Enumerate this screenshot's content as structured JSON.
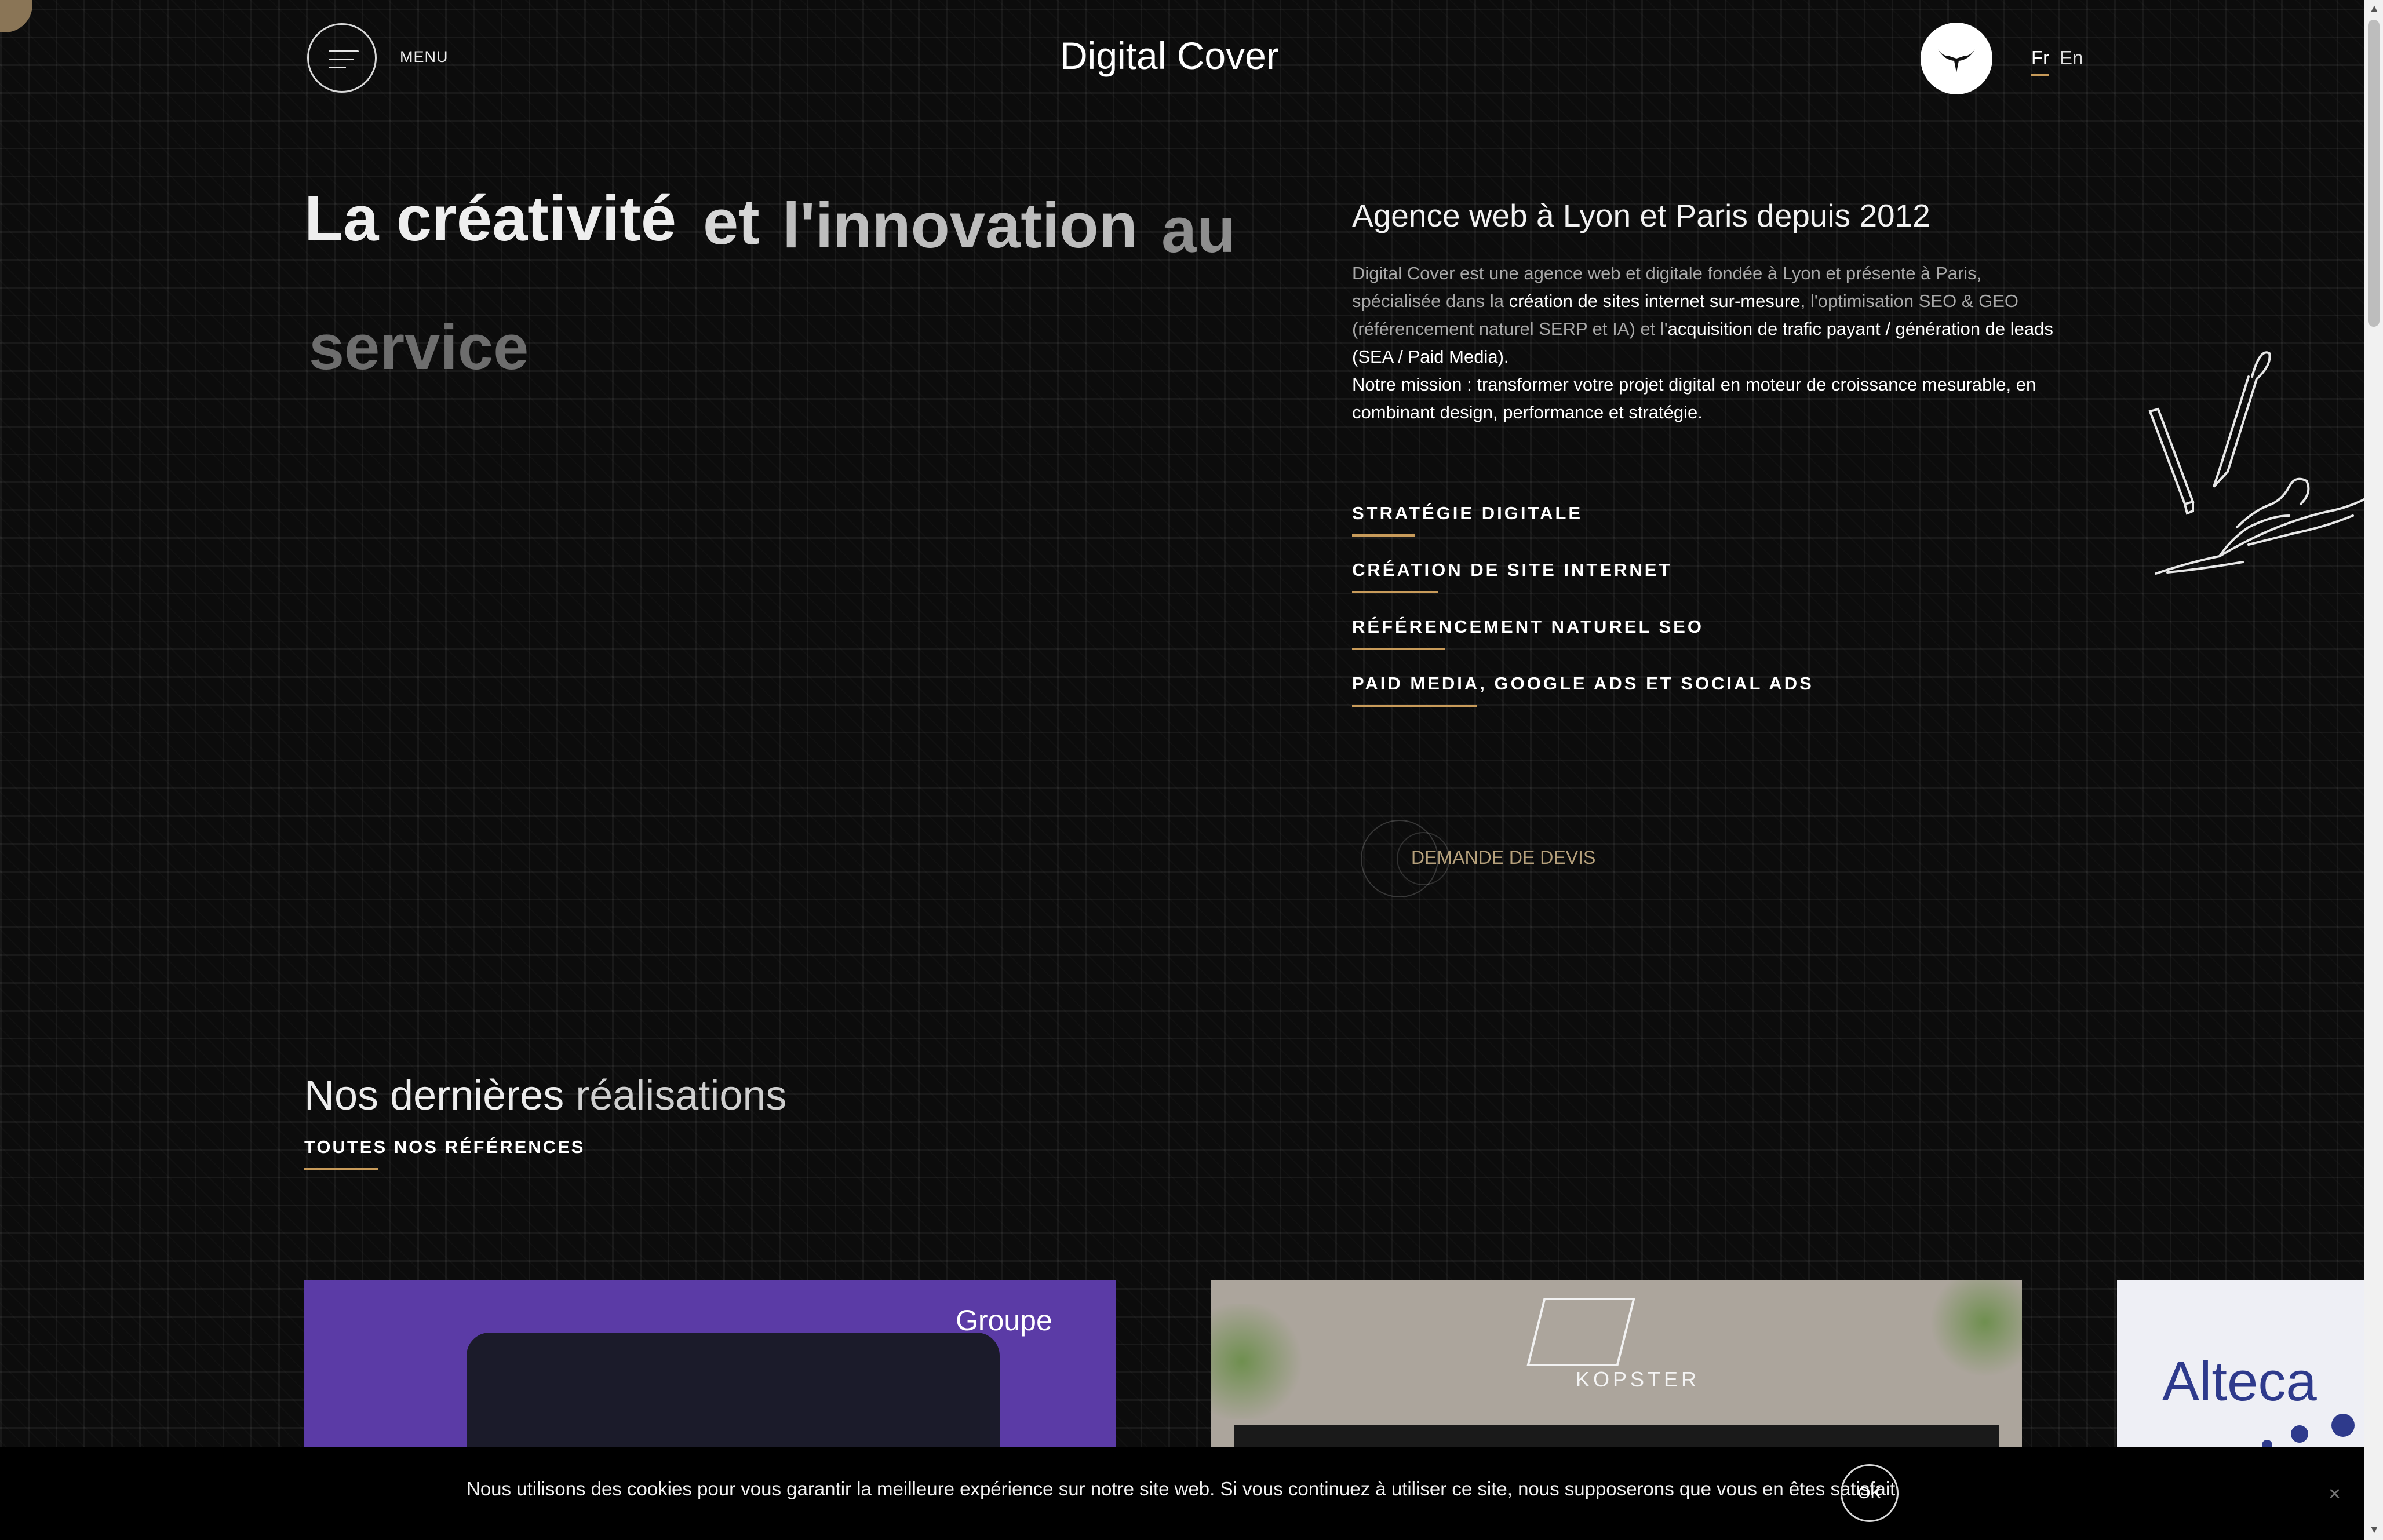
{
  "header": {
    "menu_label": "MENU",
    "brand": "Digital Cover",
    "lang_fr": "Fr",
    "lang_en": "En"
  },
  "hero": {
    "headline_words": [
      "La créativité",
      "et",
      "l'innovation",
      "au",
      "service"
    ],
    "agency_title": "Agence web à Lyon et Paris depuis 2012",
    "desc": {
      "p1": "Digital Cover est une agence web et digitale fondée à Lyon et présente à Paris, spécialisée dans la ",
      "b1": "création de sites internet sur-mesure",
      "p2": ", l'optimisation SEO & GEO (référencement naturel SERP et IA) et l'",
      "b2": "acquisition de trafic payant / génération de leads",
      "p3": " (SEA / Paid Media).",
      "mission": "Notre mission : transformer votre projet digital en moteur de croissance mesurable, en combinant design, performance et stratégie."
    },
    "services": [
      "STRATÉGIE DIGITALE",
      "CRÉATION DE SITE INTERNET",
      "RÉFÉRENCEMENT NATUREL SEO",
      "PAID MEDIA, GOOGLE ADS ET SOCIAL ADS"
    ],
    "cta": "DEMANDE DE DEVIS"
  },
  "realisations": {
    "title_a": "Nos dernières",
    "title_b": "réalisations",
    "all_refs": "TOUTES NOS RÉFÉRENCES",
    "cards": [
      {
        "label": "Groupe",
        "bg": "#5b3ba6"
      },
      {
        "label": "KOPSTER",
        "bg": "#aca59c"
      },
      {
        "label": "Alteca",
        "bg": "#eeeff5"
      }
    ]
  },
  "cookie": {
    "text": "Nous utilisons des cookies pour vous garantir la meilleure expérience sur notre site web. Si vous continuez à utiliser ce site, nous supposerons que vous en êtes satisfait.",
    "ok": "OK",
    "close": "×"
  },
  "colors": {
    "accent": "#c89b5a",
    "background": "#0c0c0c"
  },
  "icons": [
    "menu-icon",
    "bull-logo-icon",
    "hand-drawing-icon",
    "close-icon"
  ]
}
